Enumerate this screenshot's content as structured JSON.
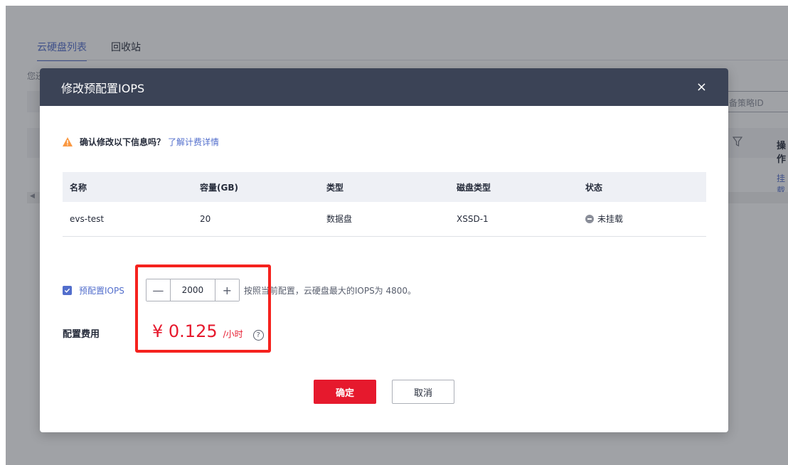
{
  "background": {
    "tabs": [
      {
        "label": "云硬盘列表"
      },
      {
        "label": "回收站"
      }
    ],
    "hint": "您还",
    "search_placeholder": "备策略ID",
    "op_header": "操作",
    "op_link": "挂载"
  },
  "dialog": {
    "title": "修改预配置IOPS",
    "close_label": "×",
    "warning": {
      "text": "确认修改以下信息吗？",
      "link": "了解计费详情"
    },
    "table": {
      "headers": [
        "名称",
        "容量(GB)",
        "类型",
        "磁盘类型",
        "状态"
      ],
      "row": {
        "name": "evs-test",
        "capacity": "20",
        "type": "数据盘",
        "disk_type": "XSSD-1",
        "status": "未挂载"
      }
    },
    "iops": {
      "label": "预配置IOPS",
      "checked": true,
      "value": "2000",
      "minus": "—",
      "plus": "+",
      "note": "按照当前配置，云硬盘最大的IOPS为 4800。"
    },
    "fee": {
      "label": "配置费用",
      "price": "¥ 0.125",
      "unit": "/小时",
      "help": "?"
    },
    "buttons": {
      "confirm": "确定",
      "cancel": "取消"
    }
  },
  "colors": {
    "accent": "#526ecc",
    "header_bg": "#3b4356",
    "danger": "#e6192d",
    "highlight": "#f5221e"
  }
}
